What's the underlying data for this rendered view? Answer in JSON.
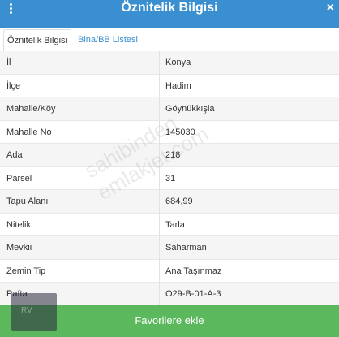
{
  "header": {
    "title": "Öznitelik Bilgisi",
    "close_glyph": "×"
  },
  "tabs": [
    {
      "label": "Öznitelik Bilgisi"
    },
    {
      "label": "Bina/BB Listesi"
    }
  ],
  "rows": [
    {
      "label": "İl",
      "value": "Konya"
    },
    {
      "label": "İlçe",
      "value": "Hadim"
    },
    {
      "label": "Mahalle/Köy",
      "value": "Göynükkışla"
    },
    {
      "label": "Mahalle No",
      "value": "145030"
    },
    {
      "label": "Ada",
      "value": "218"
    },
    {
      "label": "Parsel",
      "value": "31"
    },
    {
      "label": "Tapu Alanı",
      "value": "684,99"
    },
    {
      "label": "Nitelik",
      "value": "Tarla"
    },
    {
      "label": "Mevkii",
      "value": "Saharman"
    },
    {
      "label": "Zemin Tip",
      "value": "Ana Taşınmaz"
    },
    {
      "label": "Pafta",
      "value": "O29-B-01-A-3"
    }
  ],
  "watermark": "sahibinden emlakjet.com",
  "favorite_button": "Favorilere ekle",
  "colors": {
    "header": "#3a8fd1",
    "favorite": "#5cb85c"
  }
}
